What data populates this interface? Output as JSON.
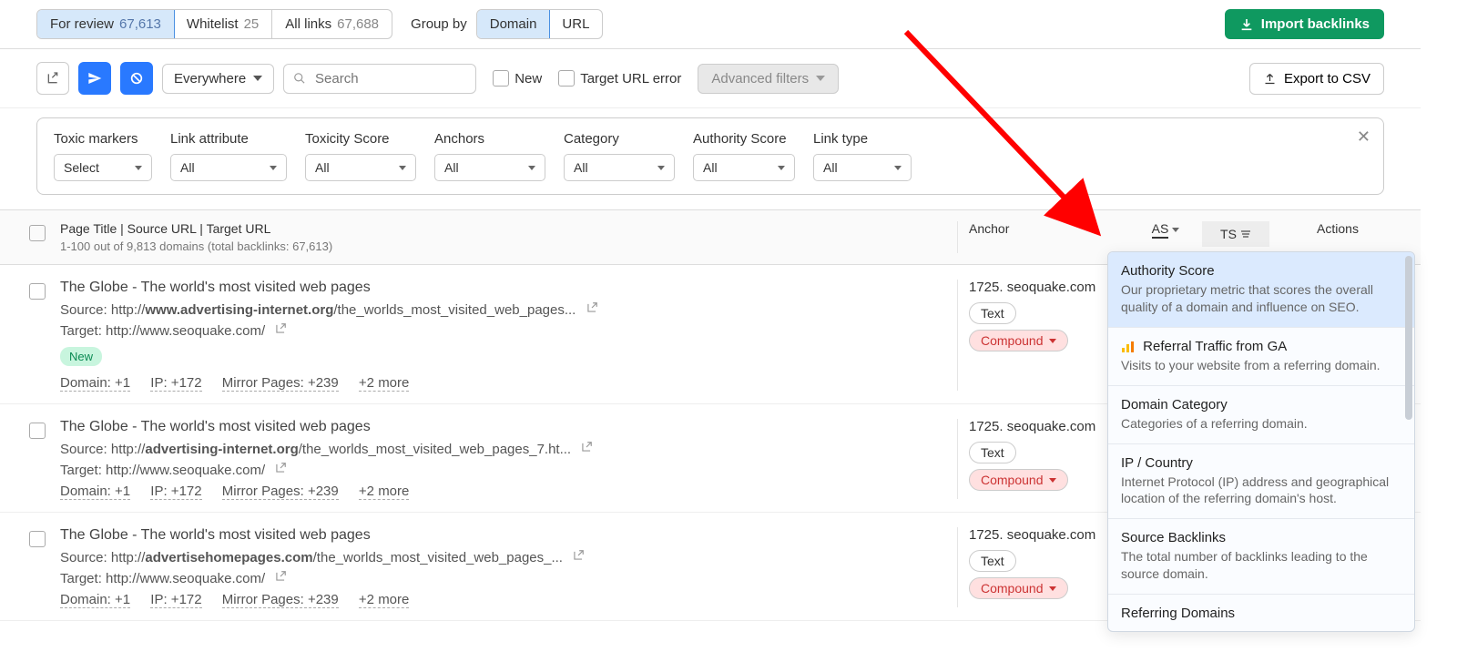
{
  "tabs": {
    "for_review_label": "For review",
    "for_review_count": "67,613",
    "whitelist_label": "Whitelist",
    "whitelist_count": "25",
    "all_links_label": "All links",
    "all_links_count": "67,688"
  },
  "group_by": {
    "label": "Group by",
    "domain": "Domain",
    "url": "URL"
  },
  "import_button": "Import backlinks",
  "toolbar": {
    "scope": "Everywhere",
    "search_placeholder": "Search",
    "new_label": "New",
    "target_err_label": "Target URL error",
    "advanced_filters": "Advanced filters",
    "export": "Export to CSV"
  },
  "filters": {
    "toxic_markers": {
      "label": "Toxic markers",
      "value": "Select"
    },
    "link_attribute": {
      "label": "Link attribute",
      "value": "All"
    },
    "toxicity_score": {
      "label": "Toxicity Score",
      "value": "All"
    },
    "anchors": {
      "label": "Anchors",
      "value": "All"
    },
    "category": {
      "label": "Category",
      "value": "All"
    },
    "authority_score": {
      "label": "Authority Score",
      "value": "All"
    },
    "link_type": {
      "label": "Link type",
      "value": "All"
    }
  },
  "table": {
    "header_title": "Page Title | Source URL | Target URL",
    "header_sub": "1-100 out of 9,813 domains (total backlinks: 67,613)",
    "anchor": "Anchor",
    "as": "AS",
    "ts": "TS",
    "actions": "Actions"
  },
  "rows": [
    {
      "title": "The Globe - The world's most visited web pages",
      "source_prefix": "Source: http://",
      "source_bold": "www.advertising-internet.org",
      "source_rest": "/the_worlds_most_visited_web_pages...",
      "target": "Target: http://www.seoquake.com/",
      "new": "New",
      "domain": "Domain: +1",
      "ip": "IP: +172",
      "mirror": "Mirror Pages: +239",
      "more": "+2 more",
      "anchor": "1725. seoquake.com",
      "pill1": "Text",
      "pill2": "Compound"
    },
    {
      "title": "The Globe - The world's most visited web pages",
      "source_prefix": "Source: http://",
      "source_bold": "advertising-internet.org",
      "source_rest": "/the_worlds_most_visited_web_pages_7.ht...",
      "target": "Target: http://www.seoquake.com/",
      "new": "",
      "domain": "Domain: +1",
      "ip": "IP: +172",
      "mirror": "Mirror Pages: +239",
      "more": "+2 more",
      "anchor": "1725. seoquake.com",
      "pill1": "Text",
      "pill2": "Compound"
    },
    {
      "title": "The Globe - The world's most visited web pages",
      "source_prefix": "Source: http://",
      "source_bold": "advertisehomepages.com",
      "source_rest": "/the_worlds_most_visited_web_pages_...",
      "target": "Target: http://www.seoquake.com/",
      "new": "",
      "domain": "Domain: +1",
      "ip": "IP: +172",
      "mirror": "Mirror Pages: +239",
      "more": "+2 more",
      "anchor": "1725. seoquake.com",
      "pill1": "Text",
      "pill2": "Compound"
    }
  ],
  "popover": {
    "items": [
      {
        "title": "Authority Score",
        "desc": "Our proprietary metric that scores the overall quality of a domain and influence on SEO."
      },
      {
        "title": "Referral Traffic from GA",
        "desc": "Visits to your website from a referring domain."
      },
      {
        "title": "Domain Category",
        "desc": "Categories of a referring domain."
      },
      {
        "title": "IP / Country",
        "desc": "Internet Protocol (IP) address and geographical location of the referring domain's host."
      },
      {
        "title": "Source Backlinks",
        "desc": "The total number of backlinks leading to the source domain."
      },
      {
        "title": "Referring Domains",
        "desc": ""
      }
    ]
  }
}
